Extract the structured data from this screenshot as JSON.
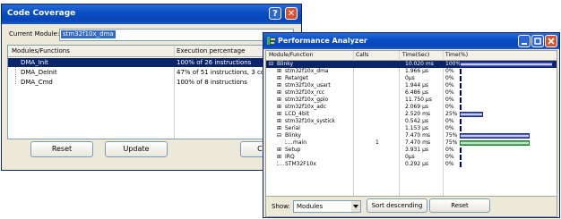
{
  "code_coverage": {
    "title": "Code Coverage",
    "help_button": "?",
    "close_button": "✕",
    "module_label": "Current Module:",
    "module_value": "stm32f10x_dma",
    "columns": [
      "Modules/Functions",
      "Execution percentage"
    ],
    "rows": [
      {
        "name": "DMA_Init",
        "value": "100% of 26 instructions"
      },
      {
        "name": "DMA_DeInit",
        "value": "47% of 51 instructions, 3 condi"
      },
      {
        "name": "DMA_Cmd",
        "value": "100% of 8 instructions"
      }
    ],
    "reset_label": "Reset",
    "update_label": "Update",
    "close_label": "Close"
  },
  "performance_analyzer": {
    "title": "Performance Analyzer",
    "columns": [
      "Module/Function",
      "Calls",
      "Time(Sec)",
      "Time(%)"
    ],
    "rows": [
      {
        "name": "Blinky",
        "calls": "",
        "time": "10.020 ms",
        "pct": "100%",
        "bar_fraction": 1.0,
        "bar_color": "#1a2aa0",
        "expander": "⊟",
        "indent": 0
      },
      {
        "name": "stm32f10x_dma",
        "calls": "",
        "time": "1.966 µs",
        "pct": "0%",
        "bar_fraction": 0,
        "bar_color": "#1a2aa0",
        "expander": "⊞",
        "indent": 1
      },
      {
        "name": "Retarget",
        "calls": "",
        "time": "0µs",
        "pct": "0%",
        "bar_fraction": 0,
        "bar_color": "#1a2aa0",
        "expander": "⊞",
        "indent": 1
      },
      {
        "name": "stm32f10x_usart",
        "calls": "",
        "time": "1.944 µs",
        "pct": "0%",
        "bar_fraction": 0,
        "bar_color": "#1a2aa0",
        "expander": "⊞",
        "indent": 1
      },
      {
        "name": "stm32f10x_rcc",
        "calls": "",
        "time": "6.486 µs",
        "pct": "0%",
        "bar_fraction": 0,
        "bar_color": "#1a2aa0",
        "expander": "⊞",
        "indent": 1
      },
      {
        "name": "stm32f10x_gpio",
        "calls": "",
        "time": "11.750 µs",
        "pct": "0%",
        "bar_fraction": 0,
        "bar_color": "#1a2aa0",
        "expander": "⊞",
        "indent": 1
      },
      {
        "name": "stm32f10x_adc",
        "calls": "",
        "time": "2.069 µs",
        "pct": "0%",
        "bar_fraction": 0,
        "bar_color": "#1a2aa0",
        "expander": "⊞",
        "indent": 1
      },
      {
        "name": "LCD_4bit",
        "calls": "",
        "time": "2.520 ms",
        "pct": "25%",
        "bar_fraction": 0.25,
        "bar_color": "#1a2aa0",
        "expander": "⊞",
        "indent": 1
      },
      {
        "name": "stm32f10x_systick",
        "calls": "",
        "time": "0.542 µs",
        "pct": "0%",
        "bar_fraction": 0,
        "bar_color": "#1a2aa0",
        "expander": "⊞",
        "indent": 1
      },
      {
        "name": "Serial",
        "calls": "",
        "time": "1.153 µs",
        "pct": "0%",
        "bar_fraction": 0,
        "bar_color": "#1a2aa0",
        "expander": "⊞",
        "indent": 1
      },
      {
        "name": "Blinky",
        "calls": "",
        "time": "7.470 ms",
        "pct": "75%",
        "bar_fraction": 0.75,
        "bar_color": "#1a2aa0",
        "expander": "⊟",
        "indent": 1
      },
      {
        "name": "main",
        "calls": "1",
        "time": "7.470 ms",
        "pct": "75%",
        "bar_fraction": 0.75,
        "bar_color": "#1e8c2e",
        "expander": "",
        "indent": 2
      },
      {
        "name": "Setup",
        "calls": "",
        "time": "3.931 µs",
        "pct": "0%",
        "bar_fraction": 0,
        "bar_color": "#1a2aa0",
        "expander": "⊞",
        "indent": 1
      },
      {
        "name": "IRQ",
        "calls": "",
        "time": "0µs",
        "pct": "0%",
        "bar_fraction": 0,
        "bar_color": "#1a2aa0",
        "expander": "⊞",
        "indent": 1
      },
      {
        "name": "STM32F10x",
        "calls": "",
        "time": "0.292 µs",
        "pct": "0%",
        "bar_fraction": 0,
        "bar_color": "#1a2aa0",
        "expander": "",
        "indent": 1
      }
    ],
    "show_label": "Show:",
    "show_value": "Modules",
    "sort_label": "Sort descending",
    "reset_label": "Reset"
  }
}
